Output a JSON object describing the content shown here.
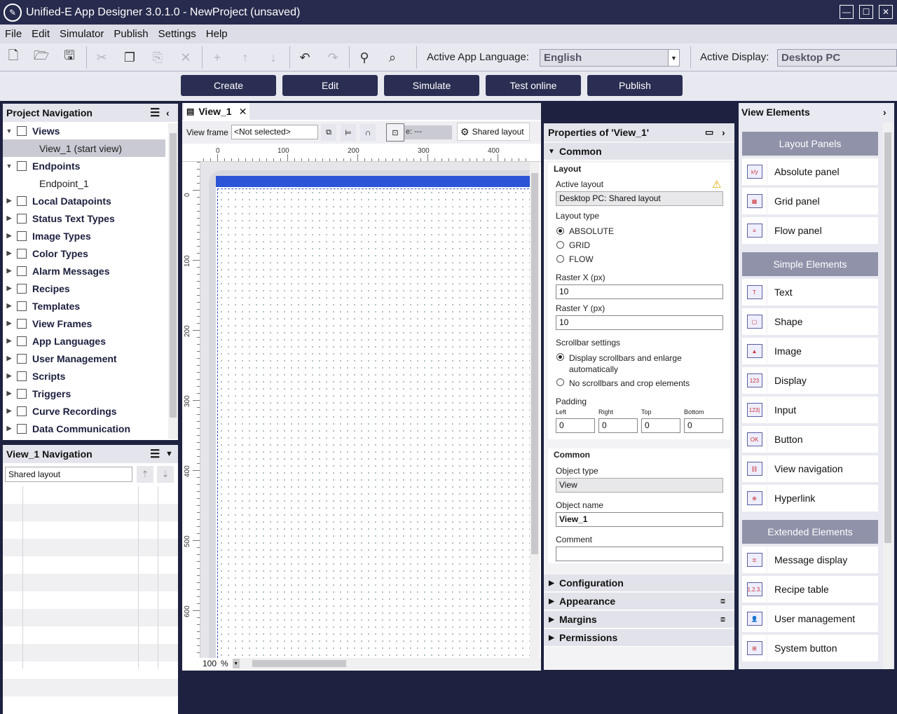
{
  "app": {
    "title": "Unified-E App Designer 3.0.1.0 - NewProject  (unsaved)"
  },
  "menu": [
    "File",
    "Edit",
    "Simulator",
    "Publish",
    "Settings",
    "Help"
  ],
  "toolbar": {
    "language_label": "Active App Language:",
    "language_value": "English",
    "display_label": "Active Display:",
    "display_value": "Desktop PC"
  },
  "modes": [
    "Create",
    "Edit",
    "Simulate",
    "Test online",
    "Publish"
  ],
  "project_nav": {
    "title": "Project Navigation",
    "items": [
      {
        "label": "Views",
        "expanded": true,
        "icon": "views-icon"
      },
      {
        "label": "View_1 (start view)",
        "child": true
      },
      {
        "label": "Endpoints",
        "expanded": true,
        "icon": "endpoints-icon"
      },
      {
        "label": "Endpoint_1",
        "child": true
      },
      {
        "label": "Local Datapoints",
        "icon": "datapoints-icon"
      },
      {
        "label": "Status Text Types",
        "icon": "status-icon"
      },
      {
        "label": "Image Types",
        "icon": "image-icon"
      },
      {
        "label": "Color Types",
        "icon": "color-icon"
      },
      {
        "label": "Alarm Messages",
        "icon": "alarm-icon"
      },
      {
        "label": "Recipes",
        "icon": "recipes-icon"
      },
      {
        "label": "Templates",
        "icon": "templates-icon"
      },
      {
        "label": "View Frames",
        "icon": "viewframes-icon"
      },
      {
        "label": "App Languages",
        "icon": "languages-icon"
      },
      {
        "label": "User Management",
        "icon": "users-icon"
      },
      {
        "label": "Scripts",
        "icon": "scripts-icon"
      },
      {
        "label": "Triggers",
        "icon": "triggers-icon"
      },
      {
        "label": "Curve Recordings",
        "icon": "curve-icon"
      },
      {
        "label": "Data Communication",
        "icon": "datacomm-icon"
      }
    ]
  },
  "view_nav": {
    "title": "View_1 Navigation",
    "layout": "Shared layout"
  },
  "editor": {
    "tab": "View_1",
    "view_frame_label": "View frame",
    "view_frame_value": "<Not selected>",
    "scale_text": "e: ---",
    "shared_layout_btn": "Shared layout",
    "ruler_x": [
      "0",
      "100",
      "200",
      "300",
      "400"
    ],
    "ruler_y": [
      "0",
      "100",
      "200",
      "300",
      "400",
      "500",
      "600"
    ],
    "zoom": "100",
    "zoom_unit": "%"
  },
  "props": {
    "title": "Properties of 'View_1'",
    "common_header": "Common",
    "layout_group": "Layout",
    "active_layout_label": "Active layout",
    "active_layout_value": "Desktop PC: Shared layout",
    "layout_type_label": "Layout type",
    "layout_types": [
      "ABSOLUTE",
      "GRID",
      "FLOW"
    ],
    "raster_x_label": "Raster X (px)",
    "raster_x": "10",
    "raster_y_label": "Raster Y (px)",
    "raster_y": "10",
    "scrollbar_label": "Scrollbar settings",
    "scroll_opt1": "Display scrollbars and enlarge",
    "scroll_opt1b": "automatically",
    "scroll_opt2": "No scrollbars and crop elements",
    "padding_label": "Padding",
    "padding": {
      "left_label": "Left",
      "right_label": "Right",
      "top_label": "Top",
      "bottom_label": "Bottom",
      "left": "0",
      "right": "0",
      "top": "0",
      "bottom": "0"
    },
    "common_group": "Common",
    "object_type_label": "Object type",
    "object_type": "View",
    "object_name_label": "Object name",
    "object_name": "View_1",
    "comment_label": "Comment",
    "comment": "",
    "sections": [
      "Configuration",
      "Appearance",
      "Margins",
      "Permissions"
    ]
  },
  "view_elements": {
    "title": "View Elements",
    "layout_panels_header": "Layout Panels",
    "layout_panels": [
      "Absolute panel",
      "Grid panel",
      "Flow panel"
    ],
    "simple_header": "Simple Elements",
    "simple": [
      "Text",
      "Shape",
      "Image",
      "Display",
      "Input",
      "Button",
      "View navigation",
      "Hyperlink"
    ],
    "extended_header": "Extended Elements",
    "extended": [
      "Message display",
      "Recipe table",
      "User management",
      "System button"
    ]
  }
}
